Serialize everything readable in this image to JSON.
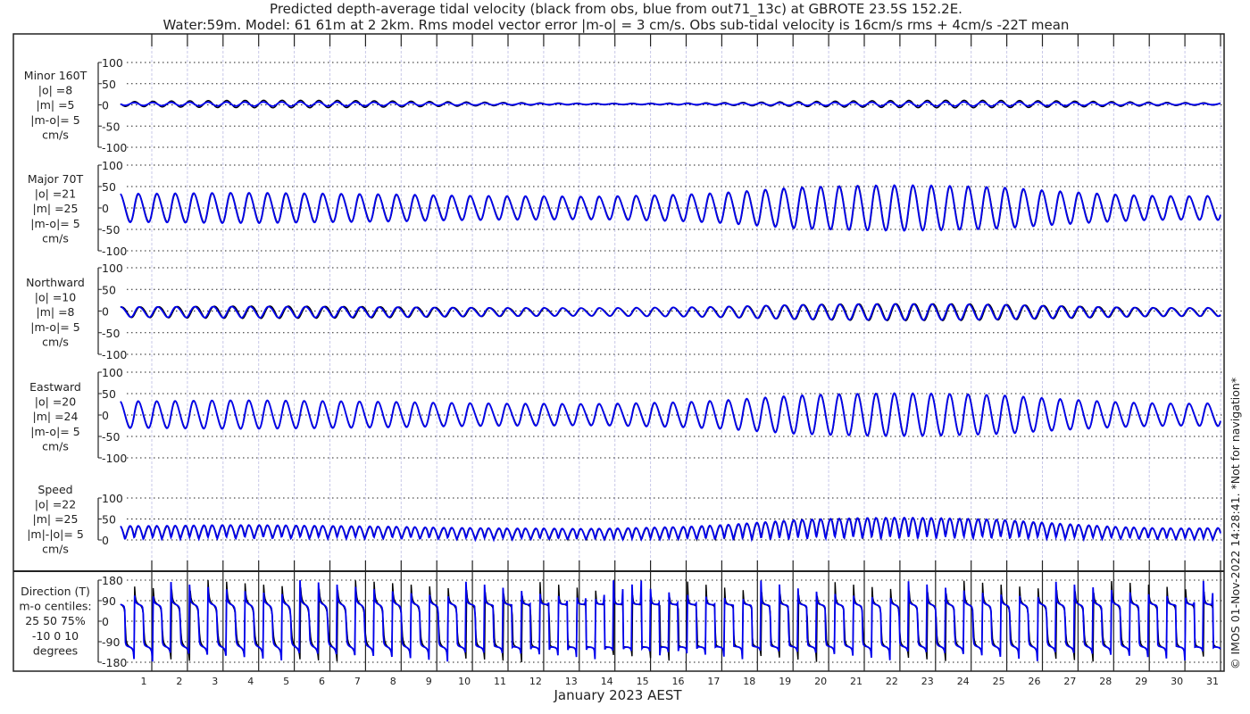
{
  "title_line1": "Predicted depth-average tidal velocity (black from obs, blue from out71_13c) at GBROTE 23.5S 152.2E.",
  "title_line2": "Water:59m. Model: 61 61m at 2 2km. Rms model vector error |m-o| = 3 cm/s. Obs sub-tidal velocity is 16cm/s rms + 4cm/s -22T mean",
  "footer_note": "© IMOS 01-Nov-2022 14:28:41. *Not for navigation*",
  "chart_data": {
    "type": "line",
    "xlabel": "January 2023 AEST",
    "x_tick_labels": [
      "1",
      "2",
      "3",
      "4",
      "5",
      "6",
      "7",
      "8",
      "9",
      "10",
      "11",
      "12",
      "13",
      "14",
      "15",
      "16",
      "17",
      "18",
      "19",
      "20",
      "21",
      "22",
      "23",
      "24",
      "25",
      "26",
      "27",
      "28",
      "29",
      "30",
      "31"
    ],
    "x_range_days": [
      0.12,
      31.0
    ],
    "legend": {
      "obs": "black",
      "model": "blue"
    },
    "colors": {
      "obs": "#000000",
      "model": "#0000ee",
      "grid": "#000000",
      "daygrid": "#c8c8e8"
    },
    "major_axis_daily_amplitude_obs": [
      32,
      33,
      34,
      34,
      33,
      32,
      31,
      30,
      28,
      27,
      26,
      26,
      25,
      26,
      28,
      30,
      34,
      40,
      46,
      50,
      52,
      52,
      51,
      50,
      46,
      40,
      35,
      30,
      27,
      26,
      27
    ],
    "major_axis_daily_amplitude_model": [
      33,
      34,
      35,
      35,
      34,
      33,
      32,
      31,
      29,
      28,
      27,
      27,
      26,
      27,
      29,
      31,
      35,
      41,
      47,
      50,
      52,
      53,
      52,
      50,
      47,
      41,
      36,
      31,
      28,
      27,
      28
    ],
    "minor_axis_amplitude_obs": 9,
    "minor_axis_amplitude_model": 5,
    "panels": [
      {
        "id": "minor",
        "labels": [
          "Minor 160T",
          "|o| =8",
          "|m| =5",
          "|m-o|= 5",
          "cm/s"
        ],
        "yticks": [
          "100",
          "50",
          "0",
          "-50",
          "-100"
        ],
        "ylim": [
          -100,
          100
        ]
      },
      {
        "id": "major",
        "labels": [
          "Major 70T",
          "|o| =21",
          "|m| =25",
          "|m-o|= 5",
          "cm/s"
        ],
        "yticks": [
          "100",
          "50",
          "0",
          "-50",
          "-100"
        ],
        "ylim": [
          -100,
          100
        ]
      },
      {
        "id": "north",
        "labels": [
          "Northward",
          "|o| =10",
          "|m| =8",
          "|m-o|= 5",
          "cm/s"
        ],
        "yticks": [
          "100",
          "50",
          "0",
          "-50",
          "-100"
        ],
        "ylim": [
          -100,
          100
        ]
      },
      {
        "id": "east",
        "labels": [
          "Eastward",
          "|o| =20",
          "|m| =24",
          "|m-o|= 5",
          "cm/s"
        ],
        "yticks": [
          "100",
          "50",
          "0",
          "-50",
          "-100"
        ],
        "ylim": [
          -100,
          100
        ]
      },
      {
        "id": "speed",
        "labels": [
          "Speed",
          "|o| =22",
          "|m| =25",
          "|m|-|o|= 5",
          "cm/s"
        ],
        "yticks": [
          "100",
          "50",
          "0"
        ],
        "ylim": [
          0,
          100
        ]
      },
      {
        "id": "direction",
        "labels": [
          "Direction (T)",
          "m-o centiles:",
          "25  50  75%",
          "-10   0  10",
          "degrees"
        ],
        "yticks": [
          "180",
          "90",
          "0",
          "-90",
          "-180"
        ],
        "ylim": [
          -180,
          180
        ]
      }
    ]
  }
}
